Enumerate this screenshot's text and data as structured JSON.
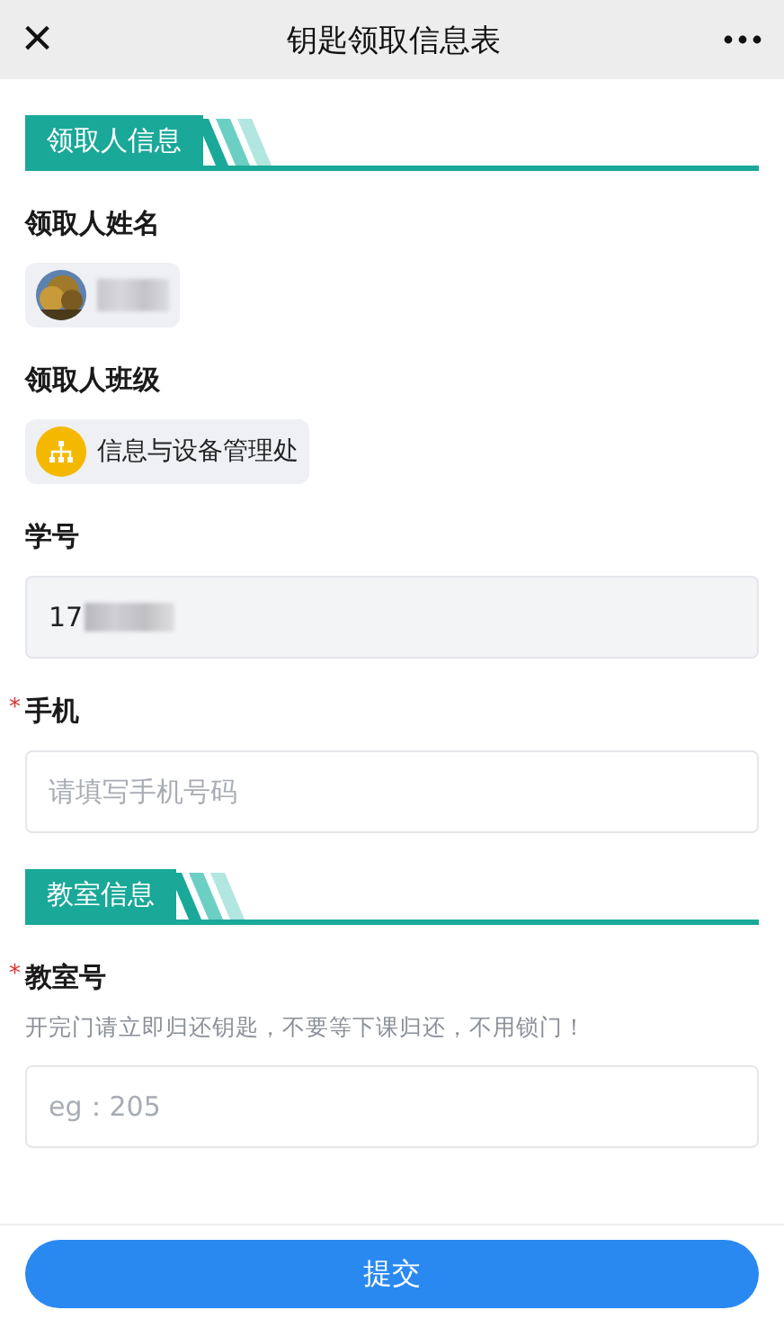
{
  "nav": {
    "title": "钥匙领取信息表",
    "close": "×"
  },
  "sections": [
    {
      "title": "领取人信息",
      "fields": [
        {
          "kind": "person",
          "label": "领取人姓名",
          "required": false
        },
        {
          "kind": "department",
          "label": "领取人班级",
          "required": false,
          "value": "信息与设备管理处"
        },
        {
          "kind": "readonly",
          "label": "学号",
          "required": false,
          "value": "17"
        },
        {
          "kind": "input",
          "label": "手机",
          "required": true,
          "placeholder": "请填写手机号码"
        }
      ]
    },
    {
      "title": "教室信息",
      "fields": [
        {
          "kind": "input",
          "label": "教室号",
          "required": true,
          "hint": "开完门请立即归还钥匙，不要等下课归还，不用锁门！",
          "placeholder": "eg：205"
        }
      ]
    }
  ],
  "required_mark": "*",
  "submit": "提交"
}
